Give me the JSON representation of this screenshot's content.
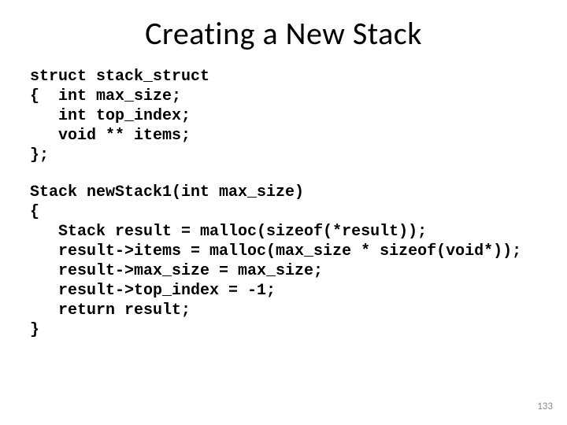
{
  "title": "Creating a New Stack",
  "code1": "struct stack_struct\n{  int max_size;\n   int top_index;\n   void ** items;\n};",
  "code2": "Stack newStack1(int max_size)\n{\n   Stack result = malloc(sizeof(*result));\n   result->items = malloc(max_size * sizeof(void*));\n   result->max_size = max_size;\n   result->top_index = -1;\n   return result;\n}",
  "page_number": "133"
}
